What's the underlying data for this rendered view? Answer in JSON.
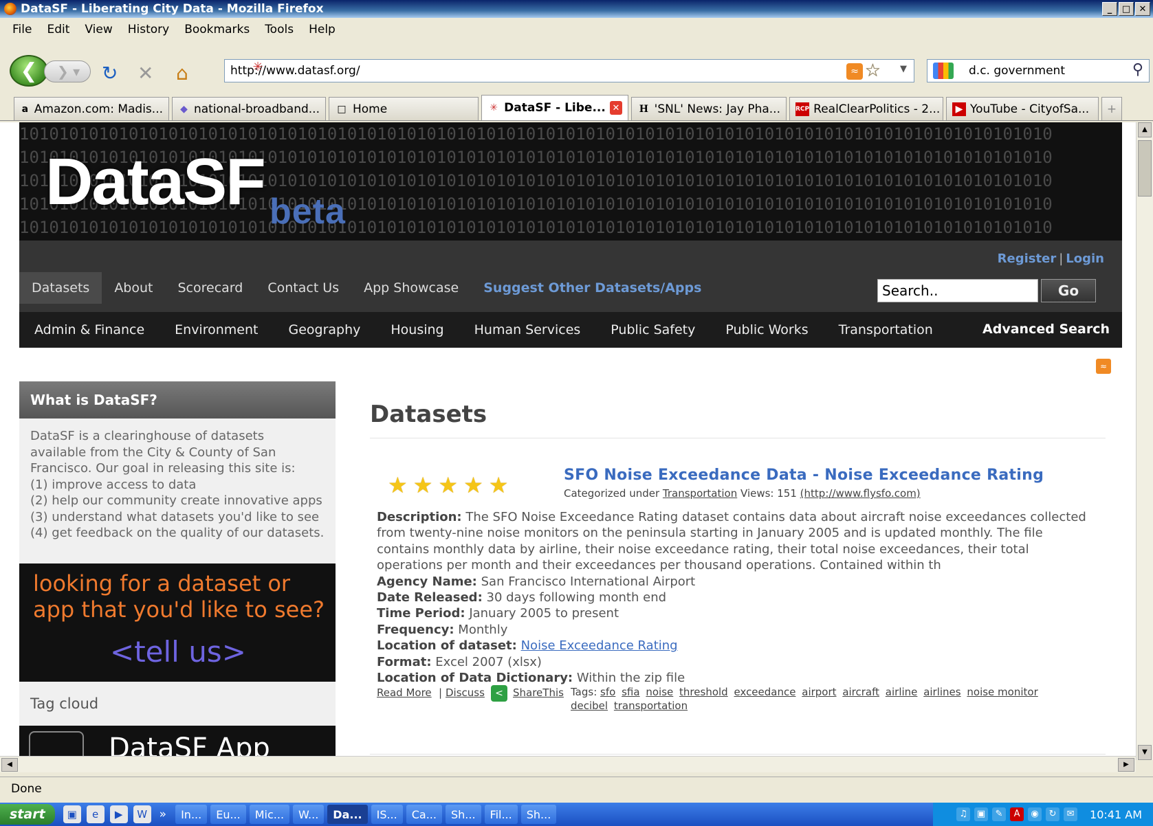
{
  "window": {
    "title": "DataSF - Liberating City Data - Mozilla Firefox",
    "controls": [
      "_",
      "□",
      "✕"
    ]
  },
  "menu": [
    "File",
    "Edit",
    "View",
    "History",
    "Bookmarks",
    "Tools",
    "Help"
  ],
  "toolbar": {
    "url": "http://www.datasf.org/",
    "search_value": "d.c. government"
  },
  "tabs": [
    {
      "label": "Amazon.com: Madis...",
      "icon": "a"
    },
    {
      "label": "national-broadband...",
      "icon": "◆"
    },
    {
      "label": "Home",
      "icon": "□"
    },
    {
      "label": "DataSF - Libe...",
      "icon": "✳"
    },
    {
      "label": "'SNL' News: Jay Pha...",
      "icon": "H"
    },
    {
      "label": "RealClearPolitics - 2...",
      "icon": "RCP"
    },
    {
      "label": "YouTube - CityofSa...",
      "icon": "▶"
    }
  ],
  "site": {
    "binary_line": "10101010101010101010101010101010101010101010101010101010101010101010101010101010101010101010101010101010",
    "logo": "DataSF",
    "logo_suffix": "beta",
    "register": "Register",
    "login": "Login",
    "nav": [
      "Datasets",
      "About",
      "Scorecard",
      "Contact Us",
      "App Showcase"
    ],
    "nav_suggest": "Suggest Other Datasets/Apps",
    "search_placeholder": "Search..",
    "go": "Go",
    "categories": [
      "Admin & Finance",
      "Environment",
      "Geography",
      "Housing",
      "Human Services",
      "Public Safety",
      "Public Works",
      "Transportation"
    ],
    "advanced_search": "Advanced Search"
  },
  "sidebar": {
    "heading": "What is DataSF?",
    "text_lines": [
      "DataSF is a clearinghouse of datasets",
      "available from the City & County of San",
      "Francisco. Our goal in releasing this site is:",
      "(1) improve access to data",
      "(2) help our community create innovative apps",
      "(3) understand what datasets you'd like to see",
      "(4) get feedback on the quality of our datasets."
    ],
    "promo_line1": "looking for a dataset or",
    "promo_line2": "app that you'd like to see?",
    "promo_cta": "<tell us>",
    "tag_cloud": "Tag cloud",
    "app_banner": "DataSF App"
  },
  "main": {
    "heading": "Datasets",
    "rating_stars": 5,
    "dataset": {
      "title": "SFO Noise Exceedance Data - Noise Exceedance Rating",
      "meta_prefix": "Categorized under",
      "meta_category": "Transportation",
      "meta_views": "Views: 151",
      "meta_link": "(http://www.flysfo.com)",
      "description_label": "Description:",
      "description": "The SFO Noise Exceedance Rating dataset contains data about aircraft noise exceedances collected from twenty-nine noise monitors on the peninsula starting in January 2005 and is updated monthly. The file contains monthly data by airline, their noise exceedance rating, their total noise exceedances, their total operations per month and their exceedances per thousand operations. Contained within th",
      "agency_label": "Agency Name:",
      "agency": "San Francisco International Airport",
      "date_label": "Date Released:",
      "date": "30 days following month end",
      "period_label": "Time Period:",
      "period": "January 2005 to present",
      "frequency_label": "Frequency:",
      "frequency": "Monthly",
      "location_label": "Location of dataset:",
      "location": "Noise Exceedance Rating",
      "format_label": "Format:",
      "format": "Excel 2007 (xlsx)",
      "dictionary_label": "Location of Data Dictionary:",
      "dictionary": "Within the zip file",
      "read_more": "Read More",
      "discuss": "Discuss",
      "share": "ShareThis",
      "tags_label": "Tags:",
      "tags": [
        "sfo",
        "sfia",
        "noise",
        "threshold",
        "exceedance",
        "airport",
        "aircraft",
        "airline",
        "airlines",
        "noise monitor",
        "decibel",
        "transportation"
      ]
    }
  },
  "status": "Done",
  "taskbar": {
    "start": "start",
    "buttons": [
      "In...",
      "Eu...",
      "Mic...",
      "W...",
      "Da...",
      "IS...",
      "Ca...",
      "Sh...",
      "Fil...",
      "Sh..."
    ],
    "active_index": 4,
    "clock": "10:41 AM"
  }
}
